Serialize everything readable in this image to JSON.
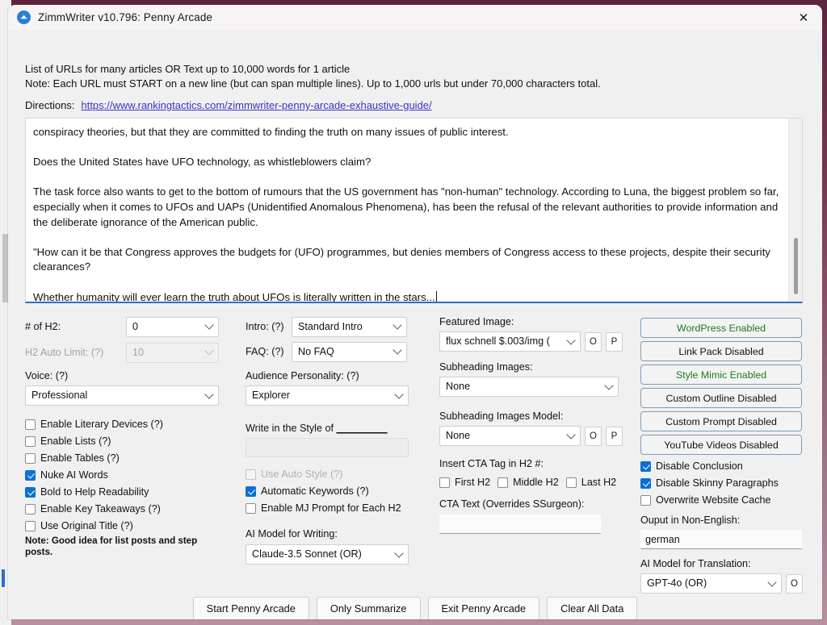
{
  "window": {
    "title": "ZimmWriter v10.796: Penny Arcade",
    "app_icon": "zimmwriter-logo-icon",
    "close_label": "✕"
  },
  "header": {
    "line1": "List of URLs for many articles OR Text up to 10,000 words for 1 article",
    "line2": "Note: Each URL must START on a new line (but can span multiple lines). Up to 1,000 urls but under 70,000 characters total.",
    "directions_label": "Directions:",
    "directions_url": "https://www.rankingtactics.com/zimmwriter-penny-arcade-exhaustive-guide/"
  },
  "editor": {
    "paragraphs": [
      "conspiracy theories, but that they are committed to finding the truth on many issues of public interest.",
      "Does the United States have UFO technology, as whistleblowers claim?",
      "The task force also wants to get to the bottom of rumours that the US government has \"non-human\" technology. According to Luna, the biggest problem so far, especially when it comes to UFOs and UAPs (Unidentified Anomalous Phenomena), has been the refusal of the relevant authorities to provide information and the deliberate ignorance of the American public.",
      "\"How can it be that Congress approves the budgets for (UFO) programmes, but denies members of Congress access to these projects, despite their security clearances?",
      "Whether humanity will ever learn the truth about UFOs is literally written in the stars..."
    ]
  },
  "left_column": {
    "h2_count_label": "# of H2:",
    "h2_count_value": "0",
    "h2_auto_limit_label": "H2 Auto Limit: (?)",
    "h2_auto_limit_value": "10",
    "voice_label": "Voice: (?)",
    "voice_value": "Professional",
    "checkboxes": [
      {
        "label": "Enable Literary Devices (?)",
        "checked": false,
        "disabled": false
      },
      {
        "label": "Enable Lists (?)",
        "checked": false,
        "disabled": false
      },
      {
        "label": "Enable Tables (?)",
        "checked": false,
        "disabled": false
      },
      {
        "label": "Nuke AI Words",
        "checked": true,
        "disabled": false
      },
      {
        "label": "Bold to Help Readability",
        "checked": true,
        "disabled": false
      },
      {
        "label": "Enable Key Takeaways (?)",
        "checked": false,
        "disabled": false
      },
      {
        "label": "Use Original Title (?)",
        "checked": false,
        "disabled": false
      }
    ],
    "note": "Note: Good idea for list posts and step posts."
  },
  "middle_column": {
    "intro_label": "Intro: (?)",
    "intro_value": "Standard Intro",
    "faq_label": "FAQ: (?)",
    "faq_value": "No FAQ",
    "audience_label": "Audience Personality: (?)",
    "audience_value": "Explorer",
    "style_label_pre": "Write in the Style of ",
    "style_label_blank": "_________",
    "style_value": "",
    "checkboxes": [
      {
        "label": "Use Auto Style (?)",
        "checked": false,
        "disabled": true
      },
      {
        "label": "Automatic Keywords (?)",
        "checked": true,
        "disabled": false
      },
      {
        "label": "Enable MJ Prompt for Each H2",
        "checked": false,
        "disabled": false
      }
    ],
    "ai_model_label": "AI Model for Writing:",
    "ai_model_value": "Claude-3.5 Sonnet (OR)"
  },
  "image_column": {
    "featured_image_label": "Featured Image:",
    "featured_image_value": "flux schnell $.003/img (",
    "featured_o_button": "O",
    "featured_p_button": "P",
    "subheading_images_label": "Subheading Images:",
    "subheading_images_value": "None",
    "subheading_model_label": "Subheading Images Model:",
    "subheading_model_value": "None",
    "subheading_o_button": "O",
    "subheading_p_button": "P",
    "cta_tag_label": "Insert CTA Tag in H2 #:",
    "cta_checkboxes": [
      {
        "label": "First H2",
        "checked": false
      },
      {
        "label": "Middle H2",
        "checked": false
      },
      {
        "label": "Last H2",
        "checked": false
      }
    ],
    "cta_text_label": "CTA Text (Overrides SSurgeon):",
    "cta_text_value": ""
  },
  "right_column": {
    "state_buttons": [
      {
        "label": "WordPress Enabled",
        "enabled": true
      },
      {
        "label": "Link Pack Disabled",
        "enabled": false
      },
      {
        "label": "Style Mimic Enabled",
        "enabled": true
      },
      {
        "label": "Custom Outline Disabled",
        "enabled": false
      },
      {
        "label": "Custom Prompt Disabled",
        "enabled": false
      },
      {
        "label": "YouTube Videos Disabled",
        "enabled": false
      }
    ],
    "checkboxes": [
      {
        "label": "Disable Conclusion",
        "checked": true
      },
      {
        "label": "Disable Skinny Paragraphs",
        "checked": true
      },
      {
        "label": "Overwrite Website Cache",
        "checked": false
      }
    ],
    "non_english_label": "Ouput in Non-English:",
    "non_english_value": "german",
    "translation_model_label": "AI Model for Translation:",
    "translation_model_value": "GPT-4o (OR)",
    "translation_o_button": "O"
  },
  "footer_buttons": [
    "Start Penny Arcade",
    "Only Summarize",
    "Exit Penny Arcade",
    "Clear All Data"
  ],
  "colors": {
    "accent_blue": "#0a70d4",
    "enabled_green": "#1f7a1f",
    "link_purple": "#3c32c8",
    "window_bg": "#f0f0f0",
    "desktop_purple": "#7b3554"
  }
}
